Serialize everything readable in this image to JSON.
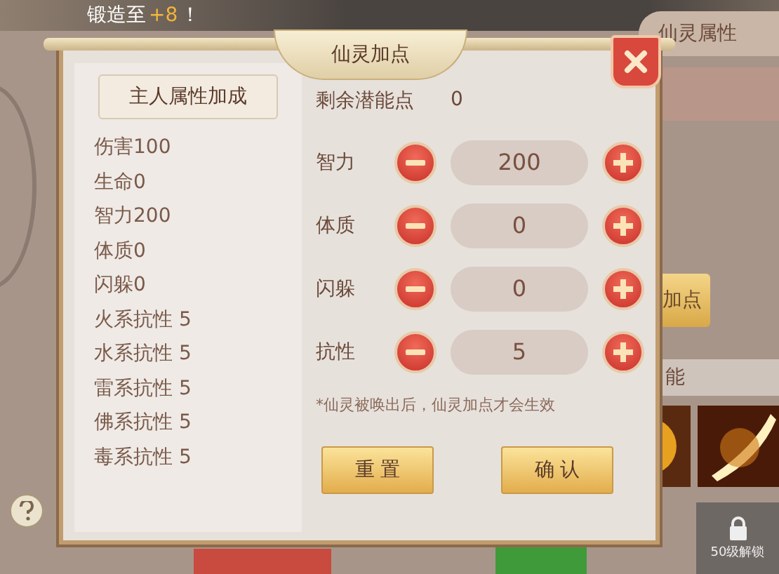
{
  "background": {
    "banner": "锻造至",
    "banner_bonus": "+8",
    "banner_end": "！",
    "tab_right": "仙灵属性",
    "side_button": "加点",
    "section": "能",
    "lock_label": "50级解锁"
  },
  "dialog": {
    "title": "仙灵加点",
    "left_header": "主人属性加成",
    "bonuses": [
      "伤害100",
      "生命0",
      "智力200",
      "体质0",
      "闪躲0",
      "火系抗性 5",
      "水系抗性 5",
      "雷系抗性 5",
      "佛系抗性 5",
      "毒系抗性 5"
    ],
    "remaining_label": "剩余潜能点",
    "remaining_value": "0",
    "stats": [
      {
        "label": "智力",
        "value": "200"
      },
      {
        "label": "体质",
        "value": "0"
      },
      {
        "label": "闪躲",
        "value": "0"
      },
      {
        "label": "抗性",
        "value": "5"
      }
    ],
    "note": "*仙灵被唤出后，仙灵加点才会生效",
    "buttons": [
      "重 置",
      "确 认"
    ]
  }
}
